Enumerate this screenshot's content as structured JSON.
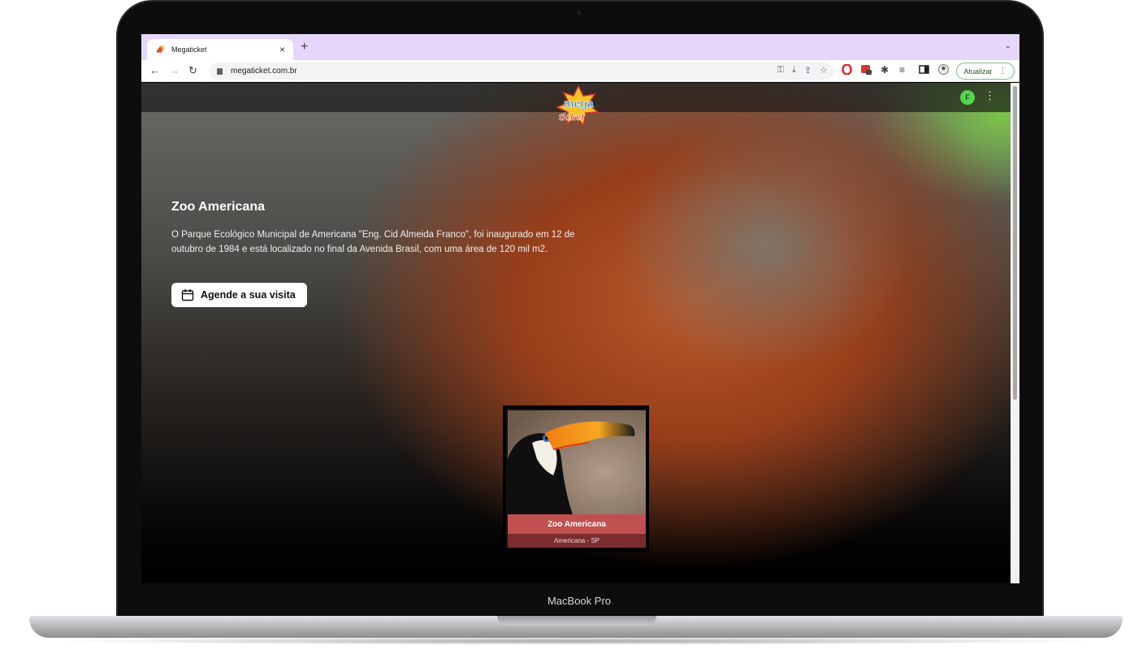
{
  "browser": {
    "tab_title": "Megaticket",
    "url": "megaticket.com.br",
    "update_label": "Atualizar"
  },
  "site": {
    "logo_text_top": "mega",
    "logo_text_bottom": "ticket",
    "user_initial": "F"
  },
  "hero": {
    "title": "Zoo Americana",
    "description": "O Parque Ecológico Municipal de Americana \"Eng. Cid Almeida Franco\", foi inaugurado em 12 de outubro de 1984 e está localizado no final da Avenida Brasil, com uma área de 120 mil m2.",
    "cta_label": "Agende a sua visita"
  },
  "card": {
    "name": "Zoo Americana",
    "location": "Americana - SP"
  },
  "device": {
    "label": "MacBook Pro"
  },
  "colors": {
    "tabstrip": "#e6d6fa",
    "card_name_bg": "#c0504f",
    "card_location_bg": "#7a2c2e",
    "avatar": "#52d74b"
  }
}
